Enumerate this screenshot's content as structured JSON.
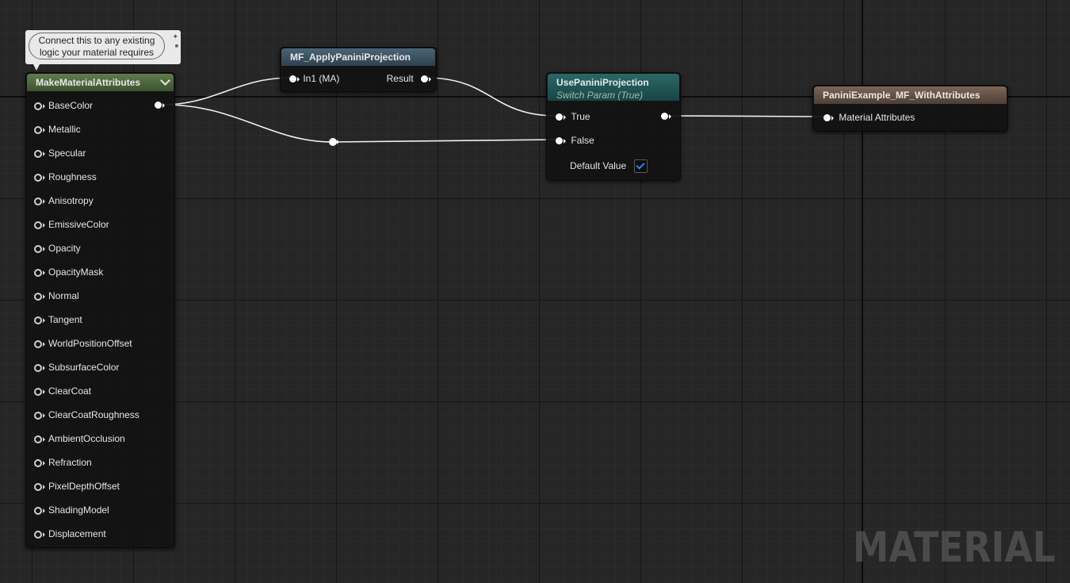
{
  "comment": {
    "text_line1": "Connect this to any existing",
    "text_line2": "logic your material requires"
  },
  "make_material_attributes": {
    "title": "MakeMaterialAttributes",
    "header_color": "#4f6b3f",
    "pins": [
      "BaseColor",
      "Metallic",
      "Specular",
      "Roughness",
      "Anisotropy",
      "EmissiveColor",
      "Opacity",
      "OpacityMask",
      "Normal",
      "Tangent",
      "WorldPositionOffset",
      "SubsurfaceColor",
      "ClearCoat",
      "ClearCoatRoughness",
      "AmbientOcclusion",
      "Refraction",
      "PixelDepthOffset",
      "ShadingModel",
      "Displacement"
    ],
    "connected_pin": "BaseColor"
  },
  "mf_apply_panini": {
    "title": "MF_ApplyPaniniProjection",
    "header_color": "#3b5263",
    "input_pin": "In1 (MA)",
    "output_pin": "Result"
  },
  "use_panini": {
    "title": "UsePaniniProjection",
    "subtitle": "Switch Param (True)",
    "header_color": "#1f5a5a",
    "pin_true": "True",
    "pin_false": "False",
    "default_value_label": "Default Value",
    "default_value_checked": true
  },
  "result_node": {
    "title": "PaniniExample_MF_WithAttributes",
    "header_color": "#6a5446",
    "input_pin": "Material Attributes"
  },
  "watermark": "MATERIAL"
}
